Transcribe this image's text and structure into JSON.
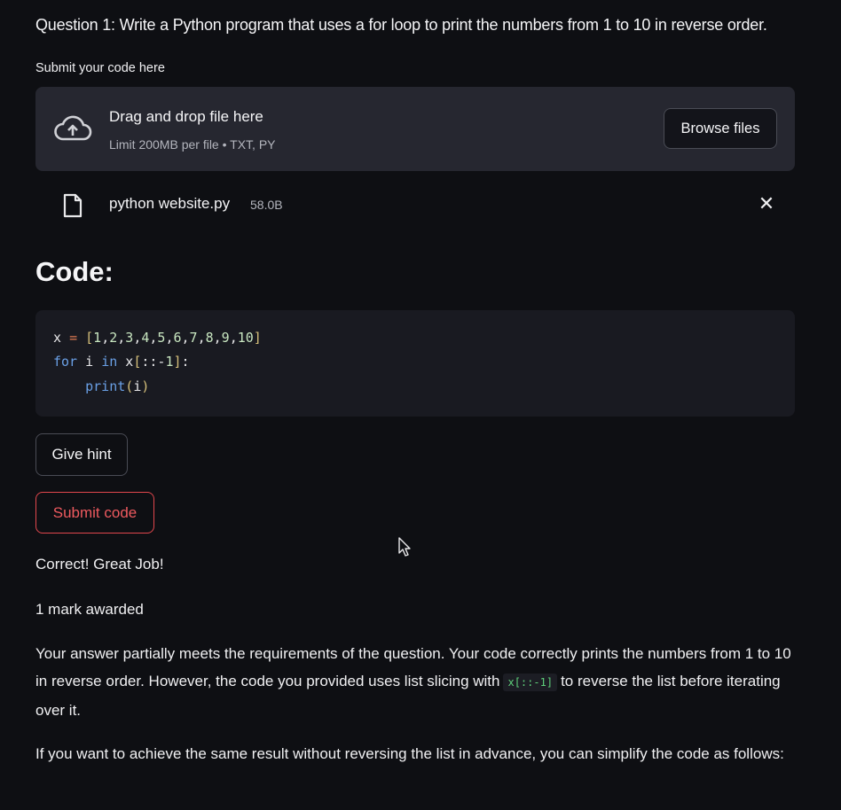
{
  "question": "Question 1: Write a Python program that uses a for loop to print the numbers from 1 to 10 in reverse order.",
  "upload": {
    "label": "Submit your code here",
    "title": "Drag and drop file here",
    "limit": "Limit 200MB per file • TXT, PY",
    "browse_label": "Browse files",
    "icon": "cloud-upload-icon"
  },
  "file": {
    "name": "python website.py",
    "size": "58.0B",
    "icon": "file-icon",
    "remove_icon": "close-icon"
  },
  "code": {
    "heading": "Code:",
    "lines": [
      "x = [1,2,3,4,5,6,7,8,9,10]",
      "for i in x[::-1]:",
      "    print(i)"
    ]
  },
  "buttons": {
    "hint": "Give hint",
    "submit": "Submit code"
  },
  "feedback": {
    "result": "Correct! Great Job!",
    "marks": "1 mark awarded",
    "explanation_before": "Your answer partially meets the requirements of the question. Your code correctly prints the numbers from 1 to 10 in reverse order. However, the code you provided uses list slicing with",
    "explanation_code": "x[::-1]",
    "explanation_after": "to reverse the list before iterating over it.",
    "suggestion": "If you want to achieve the same result without reversing the list in advance, you can simplify the code as follows:"
  },
  "colors": {
    "background": "#0e0f13",
    "panel": "#262730",
    "code_bg": "#191a21",
    "accent_red": "#e2474d",
    "inline_code": "#5ecf7a"
  }
}
